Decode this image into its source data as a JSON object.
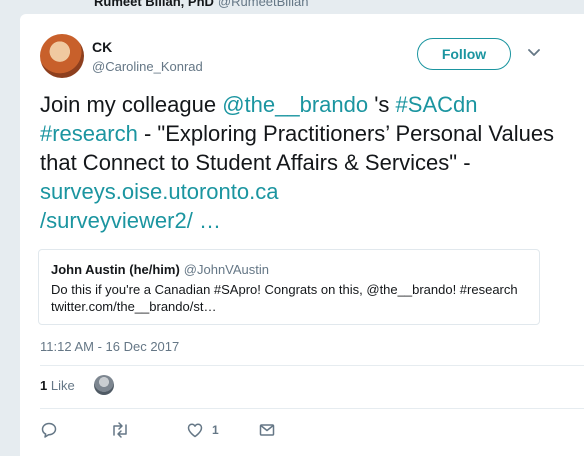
{
  "previous_tweet": {
    "name": "Rumeet Billan, PhD",
    "handle": "@RumeetBillan"
  },
  "author": {
    "name": "CK",
    "handle": "@Caroline_Konrad"
  },
  "follow_label": "Follow",
  "tweet": {
    "p1": "Join my colleague ",
    "mention": "@the__brando",
    "p2": " 's ",
    "hashtag1": "#SACdn",
    "p3": " ",
    "hashtag2": "#research",
    "p4": " - \"Exploring Practitioners’ Personal Values that Connect to Student Affairs & Services\" - ",
    "url_line1": "surveys.oise.utoronto.ca",
    "url_line2": "/surveyviewer2/ …"
  },
  "quoted": {
    "name": "John Austin (he/him)",
    "handle": "@JohnVAustin",
    "text": "Do this if you're a Canadian #SApro! Congrats on this, @the__brando! #research twitter.com/the__brando/st…"
  },
  "timestamp": "11:12 AM - 16 Dec 2017",
  "likes": {
    "count": "1",
    "label": "Like"
  },
  "actions": {
    "like_count": "1"
  },
  "icons": [
    "chevron-down-icon",
    "reply-icon",
    "retweet-icon",
    "heart-icon",
    "direct-message-icon"
  ],
  "colors": {
    "accent": "#1b95a0",
    "text": "#14171a",
    "secondary": "#657786",
    "background": "#e6ecf0"
  }
}
